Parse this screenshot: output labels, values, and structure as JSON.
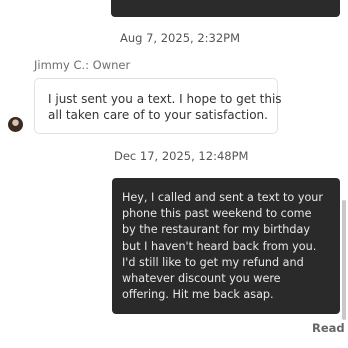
{
  "thread": {
    "timestamp_1": "Aug 7, 2025, 2:32PM",
    "sender_label": "Jimmy C.: Owner",
    "incoming_message_lines": [
      "I just sent you a text. I hope to get this",
      "all taken care of to your satisfaction."
    ],
    "timestamp_2": "Dec 17, 2025, 12:48PM",
    "outgoing_message_lines": [
      "Hey, I called and sent a text to your",
      "phone this past weekend to come",
      "by the restaurant for my birthday",
      "but I haven't heard back from you.",
      "I'd still like to get my refund and",
      "whatever discount you were",
      "offering. Hit me back asap."
    ],
    "read_receipt": "Read"
  },
  "colors": {
    "outgoing_bubble": "#2a2a2a",
    "incoming_border": "#e2e2e2"
  }
}
